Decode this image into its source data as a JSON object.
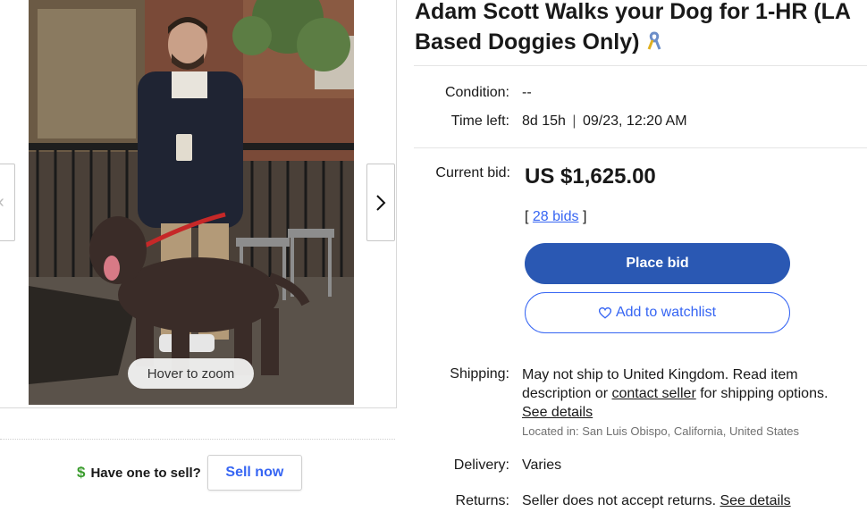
{
  "listing": {
    "title": "Adam Scott Walks your Dog for 1-HR (LA Based Doggies Only)",
    "title_icon": "awareness-ribbon-icon"
  },
  "gallery": {
    "zoom_hint": "Hover to zoom",
    "prev_icon": "chevron-left-icon",
    "next_icon": "chevron-right-icon"
  },
  "sell": {
    "icon": "dollar-icon",
    "icon_glyph": "$",
    "prompt": "Have one to sell?",
    "button": "Sell now"
  },
  "details": {
    "condition_label": "Condition:",
    "condition_value": "--",
    "time_left_label": "Time left:",
    "time_left_value": "8d 15h",
    "time_sep": "|",
    "end_time": "09/23, 12:20 AM"
  },
  "bid": {
    "current_label": "Current bid:",
    "price": "US $1,625.00",
    "bids_open": "[",
    "bids_link": "28 bids",
    "bids_close": "]",
    "place_bid": "Place bid",
    "watchlist": "Add to watchlist",
    "watchlist_icon": "heart-icon"
  },
  "shipping": {
    "label": "Shipping:",
    "text_1": "May not ship to United Kingdom. Read item description or",
    "contact_link": "contact seller",
    "text_2": "for shipping options.",
    "details_link": "See details",
    "located": "Located in: San Luis Obispo, California, United States"
  },
  "delivery": {
    "label": "Delivery:",
    "value": "Varies"
  },
  "returns": {
    "label": "Returns:",
    "value": "Seller does not accept returns.",
    "details_link": "See details"
  },
  "colors": {
    "primary": "#2a58b3",
    "link": "#3665f3",
    "dollar": "#3a9c2d",
    "muted": "#707070"
  }
}
